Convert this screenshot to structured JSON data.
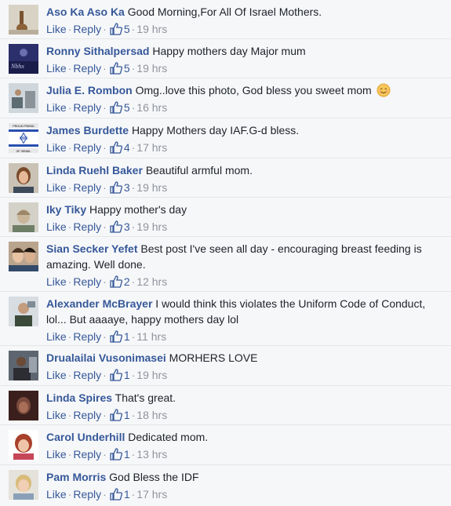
{
  "actions": {
    "like": "Like",
    "reply": "Reply",
    "separator": "·"
  },
  "comments": [
    {
      "author": "Aso Ka Aso Ka",
      "text": "Good Morning,For All Of Israel Mothers.",
      "likes": "5",
      "time": "19 hrs"
    },
    {
      "author": "Ronny Sithalpersad",
      "text": "Happy mothers day Major mum",
      "likes": "5",
      "time": "19 hrs"
    },
    {
      "author": "Julia E. Rombon",
      "text": "Omg..love this photo, God bless you sweet mom",
      "likes": "5",
      "time": "16 hrs"
    },
    {
      "author": "James Burdette",
      "text": "Happy Mothers day IAF.G-d bless.",
      "likes": "4",
      "time": "17 hrs"
    },
    {
      "author": "Linda Ruehl Baker",
      "text": "Beautiful armful mom.",
      "likes": "3",
      "time": "19 hrs"
    },
    {
      "author": "Iky Tiky",
      "text": "Happy mother's day",
      "likes": "3",
      "time": "19 hrs"
    },
    {
      "author": "Sian Secker Yefet",
      "text": "Best post I've seen all day - encouraging breast feeding is amazing. Well done.",
      "likes": "2",
      "time": "12 hrs"
    },
    {
      "author": "Alexander McBrayer",
      "text": "I would think this violates the Uniform Code of Conduct, lol... But aaaaye, happy mothers day lol",
      "likes": "1",
      "time": "11 hrs"
    },
    {
      "author": "Drualailai Vusonimasei",
      "text": "MORHERS LOVE",
      "likes": "1",
      "time": "19 hrs"
    },
    {
      "author": "Linda Spires",
      "text": "That's great.",
      "likes": "1",
      "time": "18 hrs"
    },
    {
      "author": "Carol Underhill",
      "text": "Dedicated mom.",
      "likes": "1",
      "time": "13 hrs"
    },
    {
      "author": "Pam Morris",
      "text": "God Bless the IDF",
      "likes": "1",
      "time": "17 hrs"
    }
  ],
  "avatar_badges": {
    "james_burdette_top": "PROUD FRIEND",
    "james_burdette_bottom": "OF ISRAEL"
  },
  "colors": {
    "link": "#365899",
    "meta": "#90949c",
    "text": "#1d2129"
  }
}
